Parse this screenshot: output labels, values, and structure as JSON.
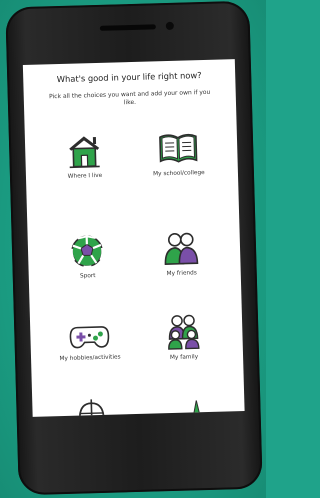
{
  "screen": {
    "title": "What's good in your life right now?",
    "subtitle": "Pick all the choices you want and add your own if you like."
  },
  "choices": [
    {
      "label": "Where I live",
      "icon": "house-icon"
    },
    {
      "label": "My school/college",
      "icon": "book-icon"
    },
    {
      "label": "Sport",
      "icon": "football-icon"
    },
    {
      "label": "My friends",
      "icon": "friends-icon"
    },
    {
      "label": "My hobbies/activities",
      "icon": "gamepad-icon"
    },
    {
      "label": "My family",
      "icon": "family-icon"
    }
  ],
  "colors": {
    "background": "#1fa38a",
    "icon_purple": "#7a4fa8",
    "icon_green": "#2fa34a",
    "icon_dark": "#2d2d2d"
  }
}
